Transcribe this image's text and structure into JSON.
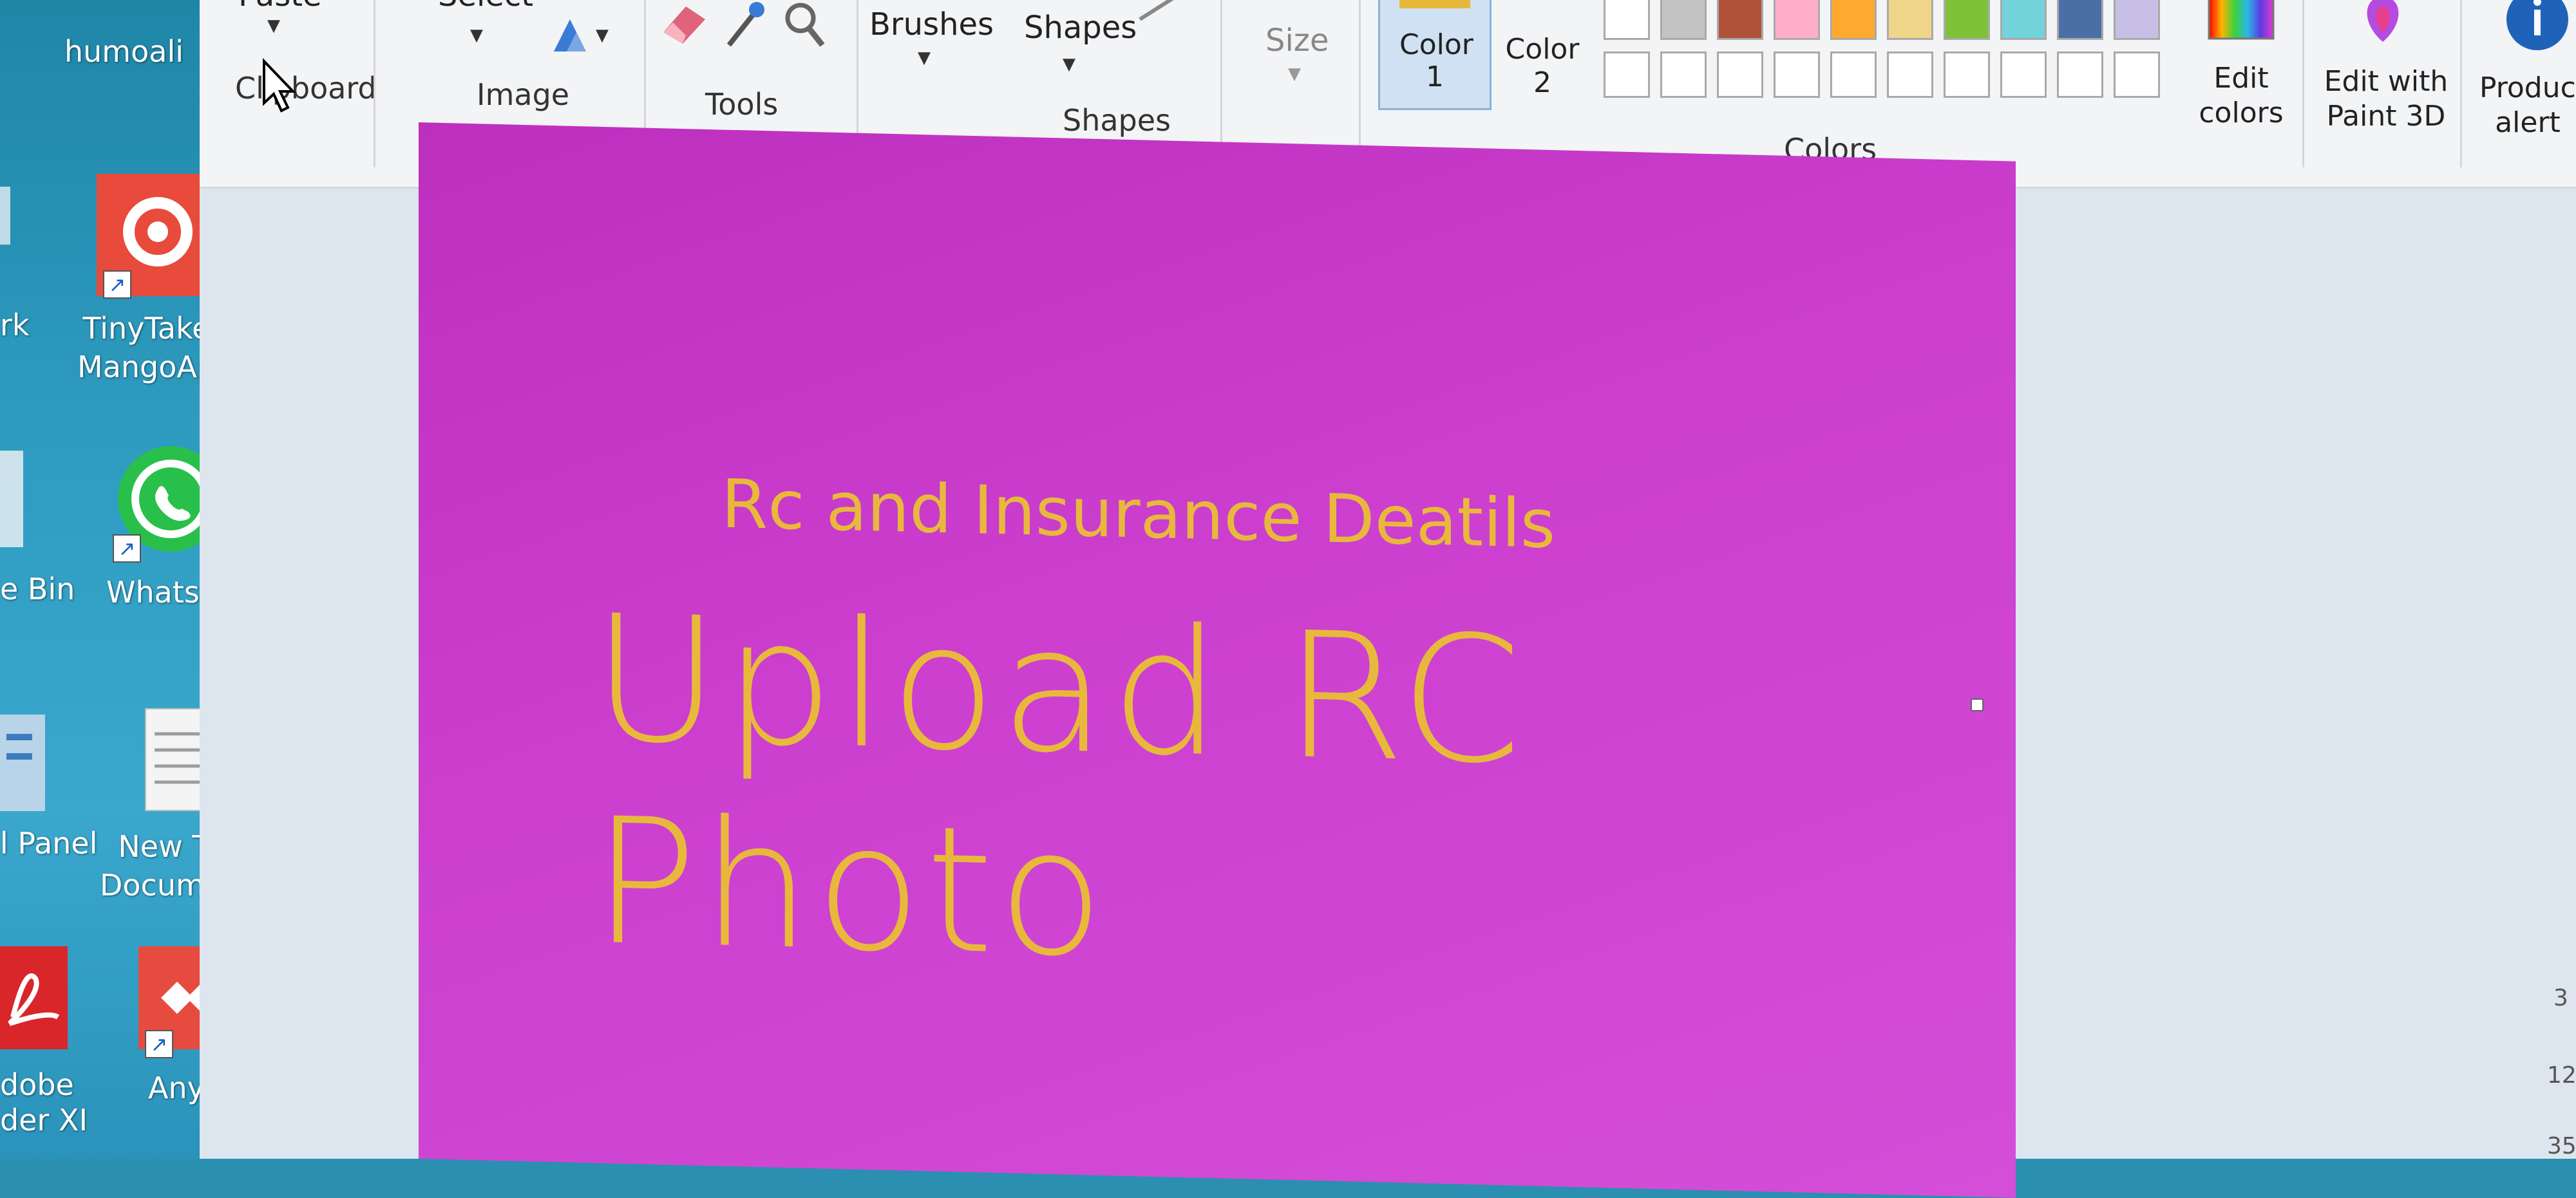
{
  "desktop": {
    "icons": [
      {
        "label_lines": [
          "humoali"
        ]
      },
      {
        "label_lines": [
          "TinyTake",
          "MangoAp"
        ]
      },
      {
        "label_lines": [
          "WhatsAp"
        ]
      },
      {
        "label_lines": [
          "New Te",
          "Documen"
        ]
      },
      {
        "label_lines": [
          "AnyDes"
        ]
      }
    ],
    "left_edge_labels": [
      "rk",
      "e Bin",
      "l Panel",
      "dobe",
      "der XI"
    ]
  },
  "ribbon": {
    "paste_label": "Paste",
    "select_label": "Select",
    "groups": {
      "clipboard": "Clipboard",
      "image": "Image",
      "tools": "Tools",
      "shapes": "Shapes",
      "colors": "Colors"
    },
    "brushes_label": "Brushes",
    "shapes_button": "Shapes",
    "size_label": "Size",
    "color1_label": [
      "Color",
      "1"
    ],
    "color2_label": [
      "Color",
      "2"
    ],
    "edit_colors": [
      "Edit",
      "colors"
    ],
    "edit_paint3d": [
      "Edit with",
      "Paint 3D"
    ],
    "product_alert": [
      "Product",
      "alert"
    ],
    "palette_row1": [
      "#ffffff",
      "#c3c3c3",
      "#b97a57",
      "#ffaec9",
      "#ffc90e",
      "#efe4b0",
      "#b5e61d",
      "#99d9ea",
      "#7092be",
      "#c8bfe7"
    ],
    "color1_value": "#e8b83d"
  },
  "canvas": {
    "subtitle": "Rc and Insurance Deatils",
    "heading": "Upload RC Photo",
    "background": "#cc3fcf",
    "text_color": "#e8b83d"
  },
  "right_edge": [
    "3",
    "12",
    "35"
  ]
}
